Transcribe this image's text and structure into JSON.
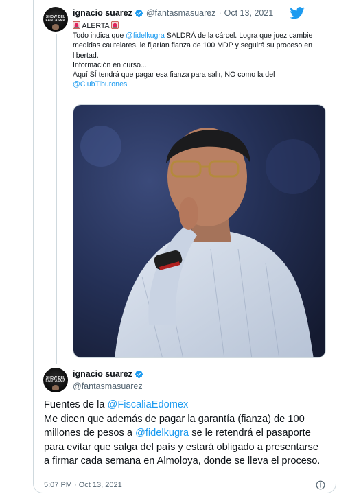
{
  "quoted_tweet": {
    "name": "ignacio suarez",
    "handle": "@fantasmasuarez",
    "separator": "·",
    "date": "Oct 13, 2021",
    "alert_label": "ALERTA",
    "line1_a": "Todo indica que ",
    "line1_mention": "@fidelkugra",
    "line1_b": " SALDRÁ de la cárcel. Logra que juez cambie medidas cautelares, le fijarían fianza de 100 MDP y seguirá su proceso en libertad.",
    "line2": "Información en curso...",
    "line3": "Aquí SÍ tendrá que pagar esa fianza para salir, NO como la del",
    "line3_mention": "@ClubTiburones"
  },
  "main_tweet": {
    "name": "ignacio suarez",
    "handle": "@fantasmasuarez",
    "line1_a": "Fuentes de la ",
    "line1_mention": "@FiscaliaEdomex",
    "line2_a": "Me dicen que además de pagar la garantía (fianza) de 100 millones de pesos a ",
    "line2_mention": "@fidelkugra",
    "line2_b": " se le retendrá el pasaporte para evitar que salga del país y estará obligado a presentarse a firmar cada semana en Almoloya, donde se lleva el proceso.",
    "time": "5:07 PM · Oct 13, 2021"
  },
  "avatar_text": "SHOW DEL FANTASMA",
  "colors": {
    "link": "#1d9bf0",
    "verified": "#1d9bf0",
    "twitter_brand": "#1d9bf0",
    "secondary_text": "#536471",
    "border": "#cfd9de"
  },
  "icons": [
    "twitter-bird-icon",
    "verified-badge-icon",
    "siren-emoji-icon",
    "info-icon"
  ]
}
